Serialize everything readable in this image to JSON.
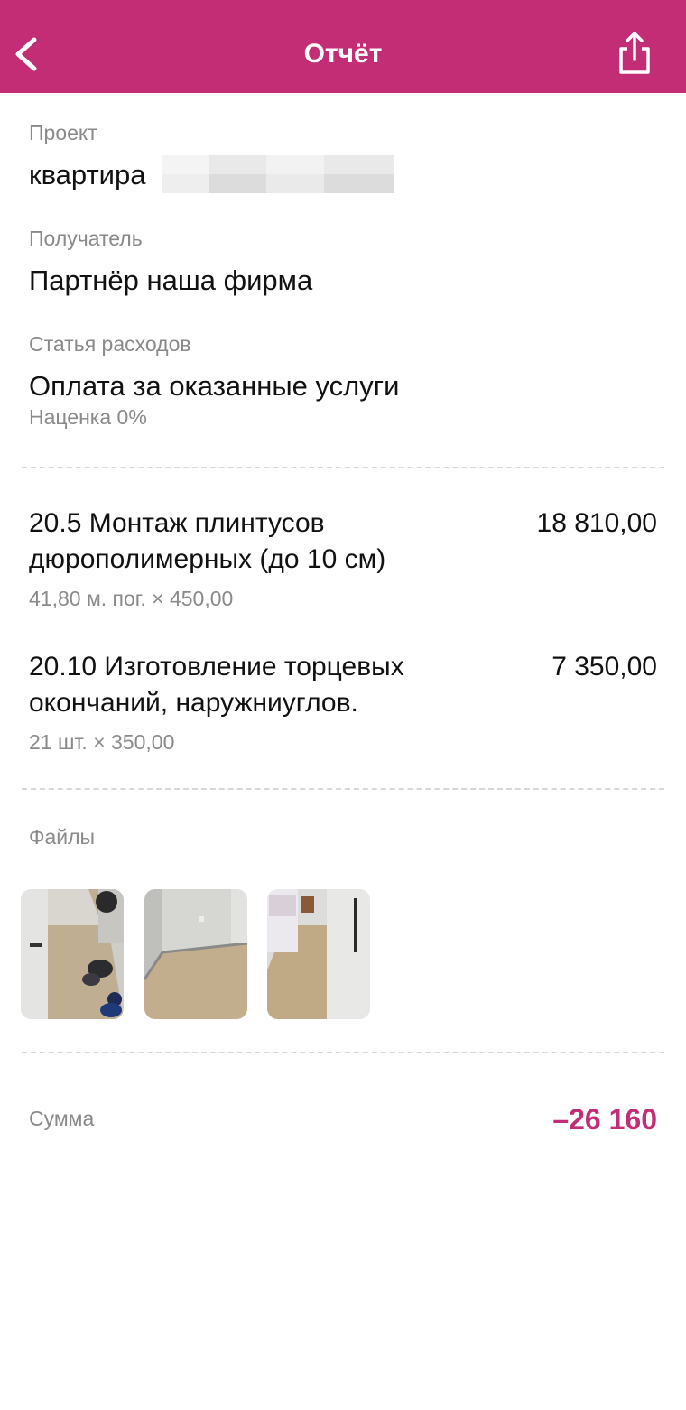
{
  "header": {
    "title": "Отчёт",
    "back_icon": "chevron-left-icon",
    "share_icon": "share-icon",
    "bg_color": "#c22d76"
  },
  "project": {
    "label": "Проект",
    "value": "квартира"
  },
  "recipient": {
    "label": "Получатель",
    "value": "Партнёр наша фирма"
  },
  "expense": {
    "label": "Статья расходов",
    "value": "Оплата за оказанные услуги",
    "markup": "Наценка 0%"
  },
  "items": [
    {
      "name": "20.5 Монтаж плинтусов дюрополимерных (до 10 см)",
      "amount": "18 810,00",
      "calc": "41,80 м. пог. × 450,00"
    },
    {
      "name": "20.10 Изготовление торцевых окончаний, наружниуглов.",
      "amount": "7 350,00",
      "calc": "21 шт. × 350,00"
    }
  ],
  "files": {
    "label": "Файлы"
  },
  "sum": {
    "label": "Сумма",
    "value": "–26 160",
    "color": "#c22d76"
  }
}
